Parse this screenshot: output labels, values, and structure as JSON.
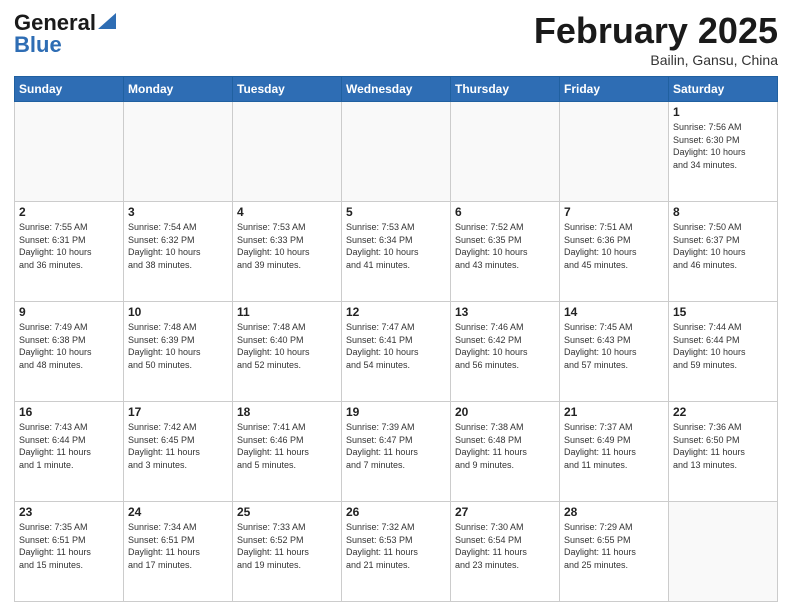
{
  "header": {
    "logo_general": "General",
    "logo_blue": "Blue",
    "month_title": "February 2025",
    "location": "Bailin, Gansu, China"
  },
  "days_of_week": [
    "Sunday",
    "Monday",
    "Tuesday",
    "Wednesday",
    "Thursday",
    "Friday",
    "Saturday"
  ],
  "weeks": [
    [
      {
        "day": "",
        "info": ""
      },
      {
        "day": "",
        "info": ""
      },
      {
        "day": "",
        "info": ""
      },
      {
        "day": "",
        "info": ""
      },
      {
        "day": "",
        "info": ""
      },
      {
        "day": "",
        "info": ""
      },
      {
        "day": "1",
        "info": "Sunrise: 7:56 AM\nSunset: 6:30 PM\nDaylight: 10 hours\nand 34 minutes."
      }
    ],
    [
      {
        "day": "2",
        "info": "Sunrise: 7:55 AM\nSunset: 6:31 PM\nDaylight: 10 hours\nand 36 minutes."
      },
      {
        "day": "3",
        "info": "Sunrise: 7:54 AM\nSunset: 6:32 PM\nDaylight: 10 hours\nand 38 minutes."
      },
      {
        "day": "4",
        "info": "Sunrise: 7:53 AM\nSunset: 6:33 PM\nDaylight: 10 hours\nand 39 minutes."
      },
      {
        "day": "5",
        "info": "Sunrise: 7:53 AM\nSunset: 6:34 PM\nDaylight: 10 hours\nand 41 minutes."
      },
      {
        "day": "6",
        "info": "Sunrise: 7:52 AM\nSunset: 6:35 PM\nDaylight: 10 hours\nand 43 minutes."
      },
      {
        "day": "7",
        "info": "Sunrise: 7:51 AM\nSunset: 6:36 PM\nDaylight: 10 hours\nand 45 minutes."
      },
      {
        "day": "8",
        "info": "Sunrise: 7:50 AM\nSunset: 6:37 PM\nDaylight: 10 hours\nand 46 minutes."
      }
    ],
    [
      {
        "day": "9",
        "info": "Sunrise: 7:49 AM\nSunset: 6:38 PM\nDaylight: 10 hours\nand 48 minutes."
      },
      {
        "day": "10",
        "info": "Sunrise: 7:48 AM\nSunset: 6:39 PM\nDaylight: 10 hours\nand 50 minutes."
      },
      {
        "day": "11",
        "info": "Sunrise: 7:48 AM\nSunset: 6:40 PM\nDaylight: 10 hours\nand 52 minutes."
      },
      {
        "day": "12",
        "info": "Sunrise: 7:47 AM\nSunset: 6:41 PM\nDaylight: 10 hours\nand 54 minutes."
      },
      {
        "day": "13",
        "info": "Sunrise: 7:46 AM\nSunset: 6:42 PM\nDaylight: 10 hours\nand 56 minutes."
      },
      {
        "day": "14",
        "info": "Sunrise: 7:45 AM\nSunset: 6:43 PM\nDaylight: 10 hours\nand 57 minutes."
      },
      {
        "day": "15",
        "info": "Sunrise: 7:44 AM\nSunset: 6:44 PM\nDaylight: 10 hours\nand 59 minutes."
      }
    ],
    [
      {
        "day": "16",
        "info": "Sunrise: 7:43 AM\nSunset: 6:44 PM\nDaylight: 11 hours\nand 1 minute."
      },
      {
        "day": "17",
        "info": "Sunrise: 7:42 AM\nSunset: 6:45 PM\nDaylight: 11 hours\nand 3 minutes."
      },
      {
        "day": "18",
        "info": "Sunrise: 7:41 AM\nSunset: 6:46 PM\nDaylight: 11 hours\nand 5 minutes."
      },
      {
        "day": "19",
        "info": "Sunrise: 7:39 AM\nSunset: 6:47 PM\nDaylight: 11 hours\nand 7 minutes."
      },
      {
        "day": "20",
        "info": "Sunrise: 7:38 AM\nSunset: 6:48 PM\nDaylight: 11 hours\nand 9 minutes."
      },
      {
        "day": "21",
        "info": "Sunrise: 7:37 AM\nSunset: 6:49 PM\nDaylight: 11 hours\nand 11 minutes."
      },
      {
        "day": "22",
        "info": "Sunrise: 7:36 AM\nSunset: 6:50 PM\nDaylight: 11 hours\nand 13 minutes."
      }
    ],
    [
      {
        "day": "23",
        "info": "Sunrise: 7:35 AM\nSunset: 6:51 PM\nDaylight: 11 hours\nand 15 minutes."
      },
      {
        "day": "24",
        "info": "Sunrise: 7:34 AM\nSunset: 6:51 PM\nDaylight: 11 hours\nand 17 minutes."
      },
      {
        "day": "25",
        "info": "Sunrise: 7:33 AM\nSunset: 6:52 PM\nDaylight: 11 hours\nand 19 minutes."
      },
      {
        "day": "26",
        "info": "Sunrise: 7:32 AM\nSunset: 6:53 PM\nDaylight: 11 hours\nand 21 minutes."
      },
      {
        "day": "27",
        "info": "Sunrise: 7:30 AM\nSunset: 6:54 PM\nDaylight: 11 hours\nand 23 minutes."
      },
      {
        "day": "28",
        "info": "Sunrise: 7:29 AM\nSunset: 6:55 PM\nDaylight: 11 hours\nand 25 minutes."
      },
      {
        "day": "",
        "info": ""
      }
    ]
  ]
}
